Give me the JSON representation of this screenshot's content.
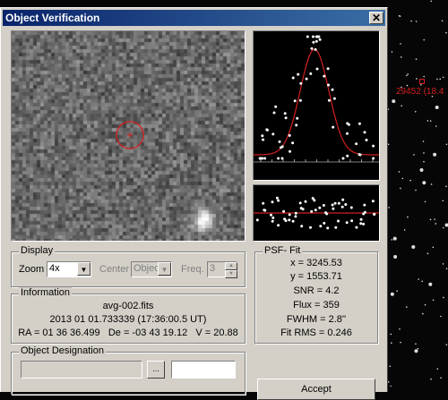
{
  "dialog": {
    "title": "Object Verification",
    "close_glyph": "✕"
  },
  "sky_label": "29452 (18.4",
  "display": {
    "group_label": "Display",
    "zoom_label": "Zoom",
    "zoom_value": "4x",
    "center_label": "Center",
    "center_value": "Object",
    "freq_label": "Freq.",
    "freq_value": "3"
  },
  "information": {
    "group_label": "Information",
    "filename": "avg-002.fits",
    "datetime": "2013 01 01.733339 (17:36:00.5 UT)",
    "coords": "RA = 01 36 36.499   De = -03 43 19.12   V = 20.88"
  },
  "psf_fit": {
    "group_label": "PSF- Fit",
    "x": "x = 3245.53",
    "y": "y = 1553.71",
    "snr": "SNR = 4.2",
    "flux": "Flux = 359",
    "fwhm": "FWHM = 2.8''",
    "fit_rms": "Fit RMS = 0.246"
  },
  "designation": {
    "group_label": "Object Designation",
    "browse_glyph": "..."
  },
  "accept_label": "Accept",
  "colors": {
    "fit_curve": "#d42020",
    "title_bar_start": "#0a246a",
    "title_bar_end": "#3a6ea5",
    "dialog_face": "#d4d0c8"
  }
}
